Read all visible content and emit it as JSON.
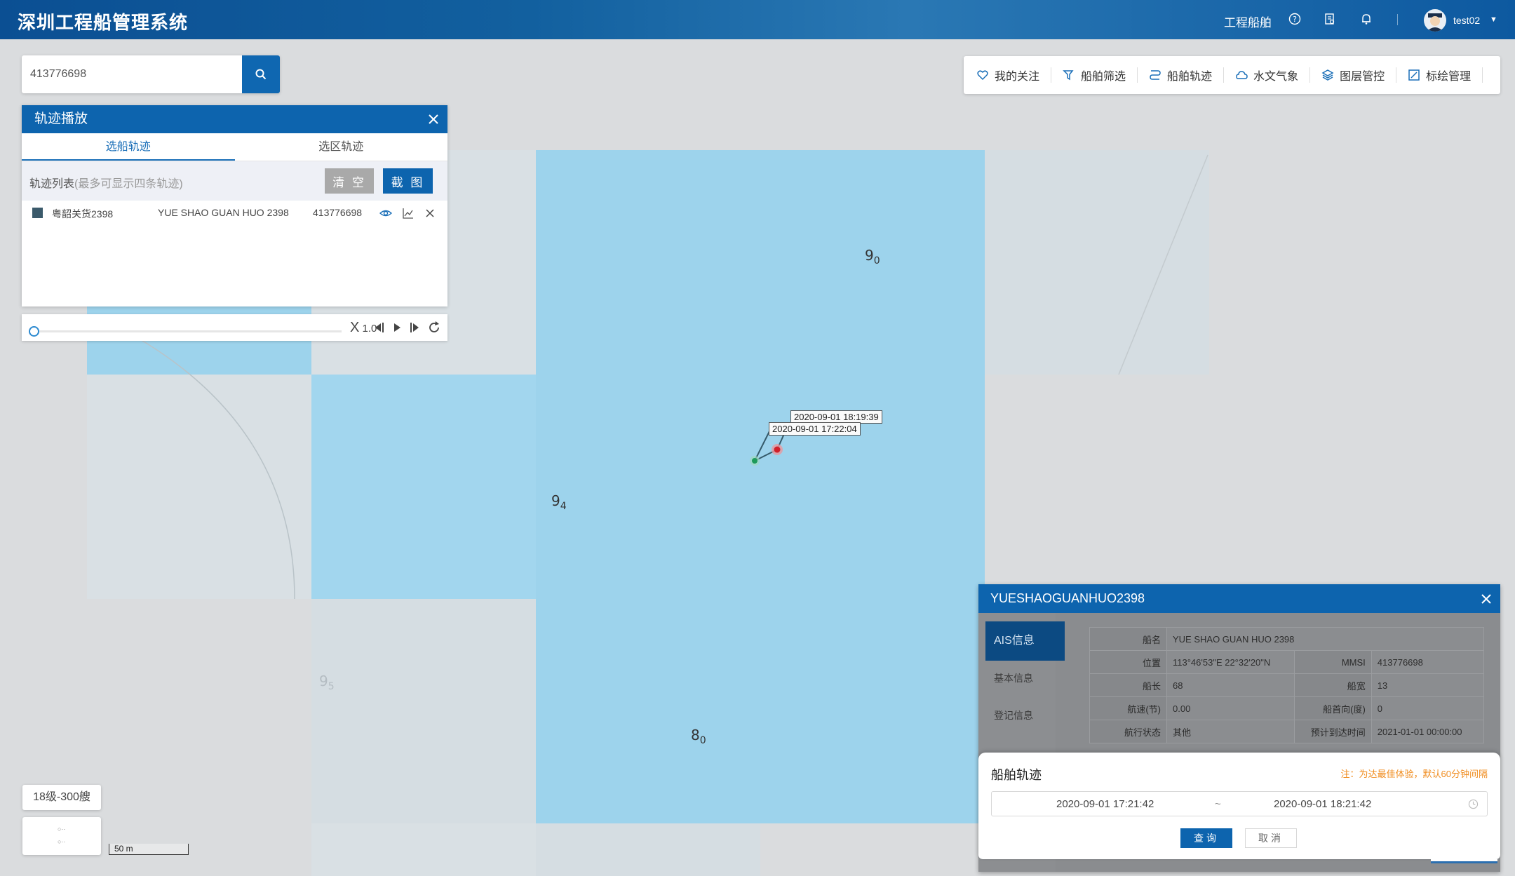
{
  "app": {
    "title": "深圳工程船管理系统"
  },
  "header": {
    "nav_item": "工程船舶",
    "username": "test02",
    "icons": [
      "help-icon",
      "document-icon",
      "bell-icon",
      "caret-down-icon"
    ]
  },
  "search": {
    "value": "413776698",
    "placeholder": ""
  },
  "toolbar": {
    "items": [
      {
        "label": "我的关注",
        "icon": "heart-icon"
      },
      {
        "label": "船舶筛选",
        "icon": "filter-icon"
      },
      {
        "label": "船舶轨迹",
        "icon": "route-icon"
      },
      {
        "label": "水文气象",
        "icon": "weather-icon"
      },
      {
        "label": "图层管控",
        "icon": "layers-icon"
      },
      {
        "label": "标绘管理",
        "icon": "draw-icon"
      }
    ]
  },
  "playback": {
    "title": "轨迹播放",
    "tabs": [
      "选船轨迹",
      "选区轨迹"
    ],
    "active_tab": 0,
    "list_label": "轨迹列表",
    "list_hint": "(最多可显示四条轨迹)",
    "clear_label": "清 空",
    "screenshot_label": "截 图",
    "tracks": [
      {
        "name_cn": "粤韶关货2398",
        "name_en": "YUE SHAO GUAN HUO 2398",
        "mmsi": "413776698",
        "color": "#3b5a6b"
      }
    ],
    "speed_prefix": "X",
    "speed": "1.0",
    "progress": 0
  },
  "map": {
    "depths": [
      {
        "main": "9",
        "sub": "0"
      },
      {
        "main": "9",
        "sub": "4"
      },
      {
        "main": "9",
        "sub": "5"
      },
      {
        "main": "8",
        "sub": "0"
      }
    ],
    "track_labels": [
      "2020-09-01 18:19:39",
      "2020-09-01 17:22:04"
    ],
    "track_start_color": "#1d9a5a",
    "track_end_color": "#d0202a",
    "level_badge": "18级-300艘",
    "scale": "50 m"
  },
  "ship_panel": {
    "title": "YUESHAOGUANHUO2398",
    "nav": [
      "AIS信息",
      "基本信息",
      "登记信息"
    ],
    "rows": [
      [
        {
          "k": "船名",
          "v": "YUE SHAO GUAN HUO 2398"
        }
      ],
      [
        {
          "k": "位置",
          "v": "113°46'53\"E  22°32'20\"N"
        },
        {
          "k": "MMSI",
          "v": "413776698"
        }
      ],
      [
        {
          "k": "船长",
          "v": "68"
        },
        {
          "k": "船宽",
          "v": "13"
        }
      ],
      [
        {
          "k": "航速(节)",
          "v": "0.00"
        },
        {
          "k": "船首向(度)",
          "v": "0"
        }
      ],
      [
        {
          "k": "航行状态",
          "v": "其他"
        },
        {
          "k": "预计到达时间",
          "v": "2021-01-01 00:00:00"
        }
      ]
    ]
  },
  "track_query": {
    "title": "船舶轨迹",
    "note": "注：为达最佳体验，默认60分钟间隔",
    "start": "2020-09-01 17:21:42",
    "separator": "~",
    "end": "2020-09-01 18:21:42",
    "query_label": "查询",
    "cancel_label": "取消"
  }
}
